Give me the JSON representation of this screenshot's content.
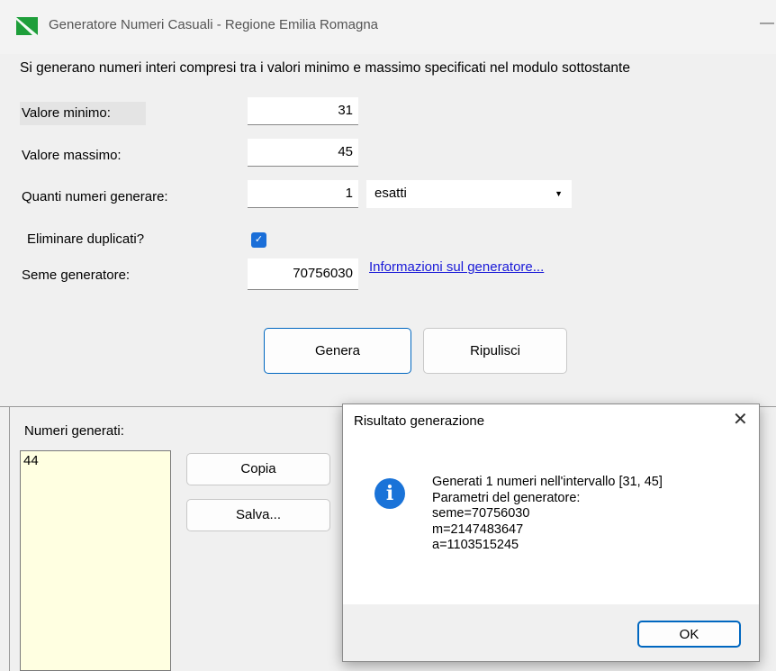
{
  "window": {
    "title": "Generatore Numeri Casuali - Regione Emilia Romagna",
    "minimize_glyph": "—"
  },
  "form": {
    "description": "Si generano numeri interi compresi tra i valori minimo e massimo specificati nel modulo sottostante",
    "min_label": "Valore minimo:",
    "min_value": "31",
    "max_label": "Valore massimo:",
    "max_value": "45",
    "count_label": "Quanti numeri generare:",
    "count_value": "1",
    "count_mode": "esatti",
    "dedup_label": "Eliminare duplicati?",
    "dedup_checked": true,
    "seed_label": "Seme generatore:",
    "seed_value": "70756030",
    "info_link": "Informazioni sul generatore..."
  },
  "buttons": {
    "generate": "Genera",
    "clear": "Ripulisci",
    "copy": "Copia",
    "save": "Salva..."
  },
  "output": {
    "label": "Numeri generati:",
    "values": "44"
  },
  "dialog": {
    "title": "Risultato generazione",
    "close_glyph": "✕",
    "icon": "information-icon",
    "lines": [
      "Generati 1 numeri nell'intervallo [31, 45]",
      "Parametri del generatore:",
      "seme=70756030",
      "m=2147483647",
      "a=1103515245"
    ],
    "ok": "OK"
  },
  "colors": {
    "accent": "#0067c0",
    "link": "#1a1ad8",
    "output_bg": "#ffffe1",
    "info_icon": "#1a73d8",
    "flag_green": "#1e9e3a"
  }
}
